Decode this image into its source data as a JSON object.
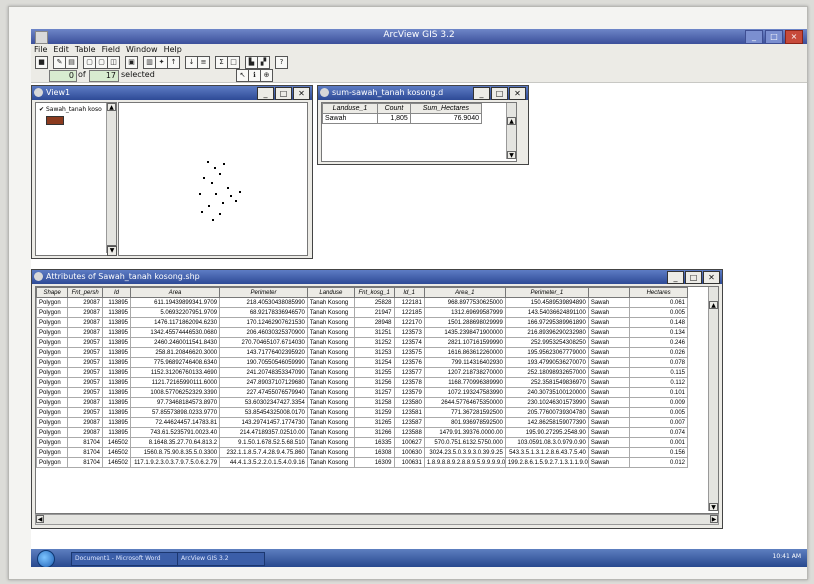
{
  "app": {
    "title": "ArcView GIS 3.2"
  },
  "menu": [
    "File",
    "Edit",
    "Table",
    "Field",
    "Window",
    "Help"
  ],
  "selection": {
    "count": "0",
    "of_label": "of",
    "total": "17",
    "selected_label": "selected"
  },
  "view_window": {
    "title": "View1",
    "legend_layer": "Sawah_tanah koso"
  },
  "stats_window": {
    "title": "sum-sawah_tanah kosong.d",
    "columns": [
      "Landuse_1",
      "Count",
      "Sum_Hectares"
    ],
    "row": [
      "Sawah",
      "1,805",
      "76.9040"
    ]
  },
  "attr_window": {
    "title": "Attributes of Sawah_tanah kosong.shp",
    "columns": [
      "Shape",
      "Fnt_persh",
      "Id",
      "Area",
      "Perimeter",
      "Landuse",
      "Fnt_kosg_1",
      "Id_1",
      "Area_1",
      "Perimeter_1",
      "",
      "Hectares"
    ],
    "rows": [
      [
        "Polygon",
        "29087",
        "113895",
        "611.19439899341.9709",
        "218.40530438085990",
        "Tanah Kosong",
        "25828",
        "122181",
        "968.8977530625000",
        "150.4589539894890",
        "Sawah",
        "0.061"
      ],
      [
        "Polygon",
        "29087",
        "113895",
        "5.06932207951.9709",
        "68.92178336946570",
        "Tanah Kosong",
        "21947",
        "122185",
        "1312.69699587999",
        "143.54036624891100",
        "Sawah",
        "0.005"
      ],
      [
        "Polygon",
        "29087",
        "113895",
        "1476.1171862094.6230",
        "170.12462907621530",
        "Tanah Kosong",
        "28948",
        "122170",
        "1501.288698029999",
        "166.97295389961890",
        "Sawah",
        "0.148"
      ],
      [
        "Polygon",
        "29087",
        "113895",
        "1342.45574446530.0680",
        "206.46030325370900",
        "Tanah Kosong",
        "31251",
        "123573",
        "1435.2398471900000",
        "216.89396290232980",
        "Sawah",
        "0.134"
      ],
      [
        "Polygon",
        "29057",
        "113895",
        "2460.2460011541.8430",
        "270.70465107.6714030",
        "Tanah Kosong",
        "31252",
        "123574",
        "2821.107161599990",
        "252.9953254308250",
        "Sawah",
        "0.246"
      ],
      [
        "Polygon",
        "29057",
        "113895",
        "258.81.20846620.3000",
        "143.71776402395920",
        "Tanah Kosong",
        "31253",
        "123575",
        "1616.863612260000",
        "195.95623067779000",
        "Sawah",
        "0.026"
      ],
      [
        "Polygon",
        "29057",
        "113895",
        "775.96892746408.6340",
        "190.70550546059990",
        "Tanah Kosong",
        "31254",
        "123576",
        "799.114316402930",
        "193.47990536270070",
        "Sawah",
        "0.078"
      ],
      [
        "Polygon",
        "29057",
        "113895",
        "1152.31206760133.4690",
        "241.20748353347090",
        "Tanah Kosong",
        "31255",
        "123577",
        "1207.218738270000",
        "252.18098932657000",
        "Sawah",
        "0.115"
      ],
      [
        "Polygon",
        "29057",
        "113895",
        "1121.72165990111.6000",
        "247.89037107129680",
        "Tanah Kosong",
        "31256",
        "123578",
        "1168.770996389990",
        "252.3581549836970",
        "Sawah",
        "0.112"
      ],
      [
        "Polygon",
        "29057",
        "113895",
        "1008.57706252329.3390",
        "227.47455076579940",
        "Tanah Kosong",
        "31257",
        "123579",
        "1072.193247583990",
        "240.30735100120000",
        "Sawah",
        "0.101"
      ],
      [
        "Polygon",
        "29087",
        "113895",
        "97.73468184573.8970",
        "53.60302347427.3354",
        "Tanah Kosong",
        "31258",
        "123580",
        "2644.57764675350000",
        "230.10246301573990",
        "Sawah",
        "0.009"
      ],
      [
        "Polygon",
        "29057",
        "113895",
        "57.85573898.0233.9770",
        "53.85454325008.0170",
        "Tanah Kosong",
        "31259",
        "123581",
        "771.367281592500",
        "205.77600739304780",
        "Sawah",
        "0.005"
      ],
      [
        "Polygon",
        "29087",
        "113895",
        "72.44624457.14783.81",
        "143.29741457.1774730",
        "Tanah Kosong",
        "31265",
        "123587",
        "801.936978592500",
        "142.86258159077390",
        "Sawah",
        "0.007"
      ],
      [
        "Polygon",
        "29087",
        "113895",
        "743.61.5235791.0023.40",
        "214.47189357.02510.00",
        "Tanah Kosong",
        "31266",
        "123588",
        "1479.91.39376.0000.00",
        "195.90.27295.2548.90",
        "Sawah",
        "0.074"
      ],
      [
        "Polygon",
        "81704",
        "146502",
        "8.1648.35.27.70.64.813.2",
        "9.1.50.1.678.52.5.68.510",
        "Tanah Kosong",
        "16335",
        "100627",
        "570.0.751.6132.5750.000",
        "103.0591.08.3.0.979.0.90",
        "Sawah",
        "0.001"
      ],
      [
        "Polygon",
        "81704",
        "146502",
        "1560.8.75.90.8.35.5.0.3300",
        "232.1.1.8.5.7.4.28.9.4.75.860",
        "Tanah Kosong",
        "16308",
        "100630",
        "3024.23.5.0.3.9.3.0.39.9.25",
        "543.3.5.1.3.1.2.8.6.43.7.5.40",
        "Sawah",
        "0.156"
      ],
      [
        "Polygon",
        "81704",
        "146502",
        "117.1.9.2.3.0.3.7.9.7.5.0.6.2.79",
        "44.4.1.3.5.2.2.0.1.5.4.0.9.16",
        "Tanah Kosong",
        "16309",
        "100631",
        "1.8.9.8.8.9.2.8.8.9.5.9.9.9.9.0",
        "199.2.8.6.1.5.9.2.7.1.3.1.1.9.0",
        "Sawah",
        "0.012"
      ]
    ]
  },
  "taskbar": {
    "items": [
      "Document1 - Microsoft Word",
      "ArcView GIS 3.2"
    ],
    "clock": "10:41 AM"
  }
}
